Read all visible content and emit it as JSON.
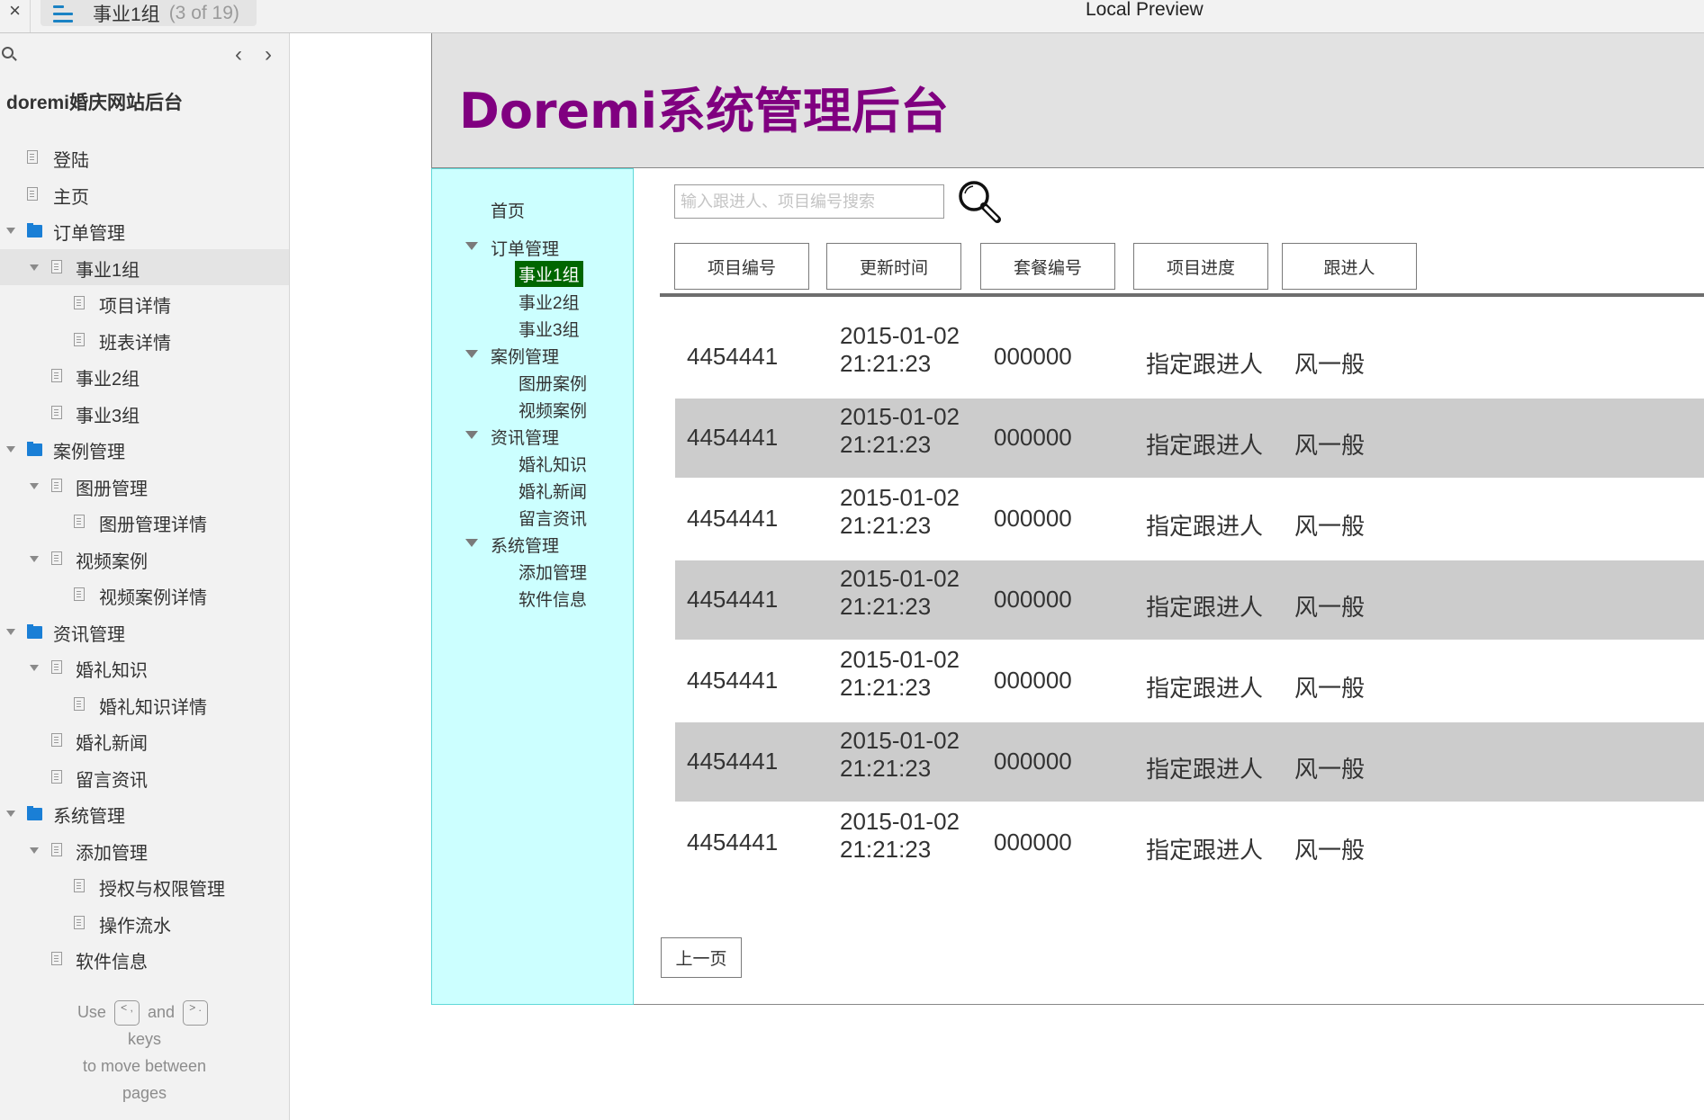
{
  "topbar": {
    "close_icon": "close-icon",
    "menu_icon": "hamburger-menu-icon",
    "page_title": "事业1组",
    "page_count": "(3 of 19)",
    "window_title": "Local Preview"
  },
  "sidebar": {
    "search_icon": "search-icon",
    "prev_label": "‹",
    "next_label": "›",
    "project_title": "doremi婚庆网站后台",
    "items": [
      {
        "label": "登陆",
        "level": 0,
        "type": "page",
        "expanded": false,
        "selected": false
      },
      {
        "label": "主页",
        "level": 0,
        "type": "page",
        "expanded": false,
        "selected": false
      },
      {
        "label": "订单管理",
        "level": 0,
        "type": "folder",
        "expanded": true,
        "selected": false
      },
      {
        "label": "事业1组",
        "level": 1,
        "type": "page",
        "expanded": true,
        "selected": true
      },
      {
        "label": "项目详情",
        "level": 2,
        "type": "page",
        "expanded": false,
        "selected": false
      },
      {
        "label": "班表详情",
        "level": 2,
        "type": "page",
        "expanded": false,
        "selected": false
      },
      {
        "label": "事业2组",
        "level": 1,
        "type": "page",
        "expanded": false,
        "selected": false
      },
      {
        "label": "事业3组",
        "level": 1,
        "type": "page",
        "expanded": false,
        "selected": false
      },
      {
        "label": "案例管理",
        "level": 0,
        "type": "folder",
        "expanded": true,
        "selected": false
      },
      {
        "label": "图册管理",
        "level": 1,
        "type": "page",
        "expanded": true,
        "selected": false
      },
      {
        "label": "图册管理详情",
        "level": 2,
        "type": "page",
        "expanded": false,
        "selected": false
      },
      {
        "label": "视频案例",
        "level": 1,
        "type": "page",
        "expanded": true,
        "selected": false
      },
      {
        "label": "视频案例详情",
        "level": 2,
        "type": "page",
        "expanded": false,
        "selected": false
      },
      {
        "label": "资讯管理",
        "level": 0,
        "type": "folder",
        "expanded": true,
        "selected": false
      },
      {
        "label": "婚礼知识",
        "level": 1,
        "type": "page",
        "expanded": true,
        "selected": false
      },
      {
        "label": "婚礼知识详情",
        "level": 2,
        "type": "page",
        "expanded": false,
        "selected": false
      },
      {
        "label": "婚礼新闻",
        "level": 1,
        "type": "page",
        "expanded": false,
        "selected": false
      },
      {
        "label": "留言资讯",
        "level": 1,
        "type": "page",
        "expanded": false,
        "selected": false
      },
      {
        "label": "系统管理",
        "level": 0,
        "type": "folder",
        "expanded": true,
        "selected": false
      },
      {
        "label": "添加管理",
        "level": 1,
        "type": "page",
        "expanded": true,
        "selected": false
      },
      {
        "label": "授权与权限管理",
        "level": 2,
        "type": "page",
        "expanded": false,
        "selected": false
      },
      {
        "label": "操作流水",
        "level": 2,
        "type": "page",
        "expanded": false,
        "selected": false
      },
      {
        "label": "软件信息",
        "level": 1,
        "type": "page",
        "expanded": false,
        "selected": false
      }
    ],
    "hint": {
      "use": "Use",
      "key_prev": "< ,",
      "and": "and",
      "key_next": "> .",
      "line2": "keys",
      "line3": "to move between",
      "line4": "pages"
    }
  },
  "app": {
    "title": "Doremi系统管理后台",
    "title_color": "#800080",
    "nav_bg_color": "#ccffff",
    "active_color": "#006600",
    "nav": [
      {
        "label": "首页",
        "type": "link"
      },
      {
        "label": "订单管理",
        "type": "group"
      },
      {
        "label": "事业1组",
        "type": "sub",
        "active": true
      },
      {
        "label": "事业2组",
        "type": "sub"
      },
      {
        "label": "事业3组",
        "type": "sub"
      },
      {
        "label": "案例管理",
        "type": "group"
      },
      {
        "label": "图册案例",
        "type": "sub"
      },
      {
        "label": "视频案例",
        "type": "sub"
      },
      {
        "label": "资讯管理",
        "type": "group"
      },
      {
        "label": "婚礼知识",
        "type": "sub"
      },
      {
        "label": "婚礼新闻",
        "type": "sub"
      },
      {
        "label": "留言资讯",
        "type": "sub"
      },
      {
        "label": "系统管理",
        "type": "group"
      },
      {
        "label": "添加管理",
        "type": "sub"
      },
      {
        "label": "软件信息",
        "type": "sub"
      }
    ],
    "search": {
      "placeholder": "输入跟进人、项目编号搜索",
      "value": "",
      "icon": "magnifier-icon"
    },
    "columns": [
      "项目编号",
      "更新时间",
      "套餐编号",
      "项目进度",
      "跟进人"
    ],
    "rows": [
      {
        "id": "4454441",
        "date": "2015-01-02",
        "time": "21:21:23",
        "package": "000000",
        "progress": "指定跟进人",
        "owner": "风一般"
      },
      {
        "id": "4454441",
        "date": "2015-01-02",
        "time": "21:21:23",
        "package": "000000",
        "progress": "指定跟进人",
        "owner": "风一般"
      },
      {
        "id": "4454441",
        "date": "2015-01-02",
        "time": "21:21:23",
        "package": "000000",
        "progress": "指定跟进人",
        "owner": "风一般"
      },
      {
        "id": "4454441",
        "date": "2015-01-02",
        "time": "21:21:23",
        "package": "000000",
        "progress": "指定跟进人",
        "owner": "风一般"
      },
      {
        "id": "4454441",
        "date": "2015-01-02",
        "time": "21:21:23",
        "package": "000000",
        "progress": "指定跟进人",
        "owner": "风一般"
      },
      {
        "id": "4454441",
        "date": "2015-01-02",
        "time": "21:21:23",
        "package": "000000",
        "progress": "指定跟进人",
        "owner": "风一般"
      },
      {
        "id": "4454441",
        "date": "2015-01-02",
        "time": "21:21:23",
        "package": "000000",
        "progress": "指定跟进人",
        "owner": "风一般"
      }
    ],
    "prev_page_label": "上一页"
  }
}
